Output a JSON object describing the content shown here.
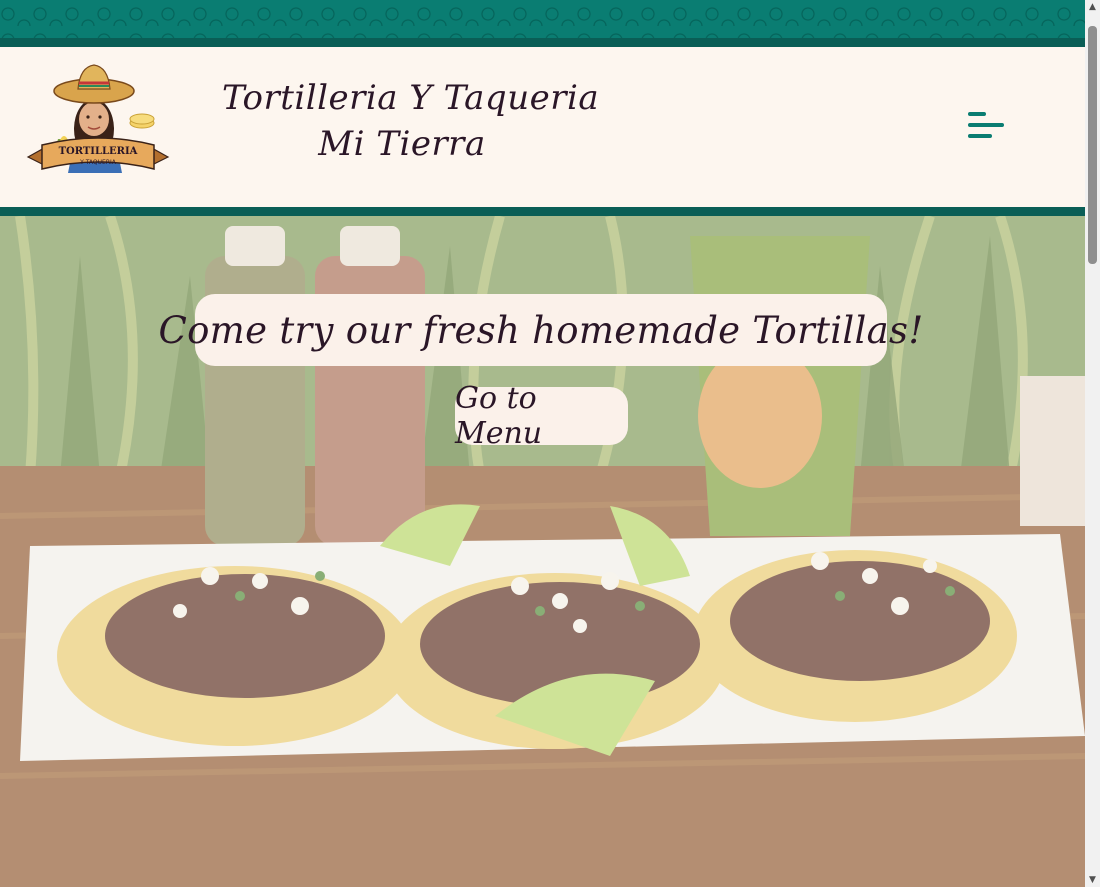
{
  "brand": {
    "title_line1": "Tortilleria Y Taqueria",
    "title_line2": "Mi Tierra",
    "logo_text_line1": "TORTILLERIA",
    "logo_text_line2": "Y TAQUERIA",
    "accent_color": "#0a7d72",
    "accent_dark": "#0a5e56",
    "text_color": "#2a1627"
  },
  "nav": {
    "menu_icon": "hamburger-menu-icon"
  },
  "hero": {
    "headline": "Come try our fresh homemade Tortillas!",
    "cta_label": "Go to Menu"
  }
}
